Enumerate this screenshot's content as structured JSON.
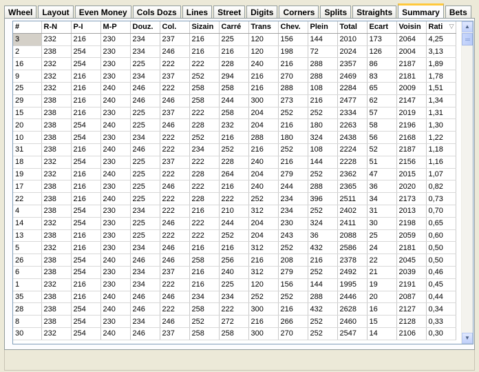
{
  "tabs": [
    {
      "label": "Wheel",
      "active": false
    },
    {
      "label": "Layout",
      "active": false
    },
    {
      "label": "Even Money",
      "active": false
    },
    {
      "label": "Cols Dozs",
      "active": false
    },
    {
      "label": "Lines",
      "active": false
    },
    {
      "label": "Street",
      "active": false
    },
    {
      "label": "Digits",
      "active": false
    },
    {
      "label": "Corners",
      "active": false
    },
    {
      "label": "Splits",
      "active": false
    },
    {
      "label": "Straights",
      "active": false
    },
    {
      "label": "Summary",
      "active": true
    },
    {
      "label": "Bets",
      "active": false
    }
  ],
  "table": {
    "columns": [
      "#",
      "R-N",
      "P-I",
      "M-P",
      "Douz.",
      "Col.",
      "Sizain",
      "Carré",
      "Trans",
      "Chev.",
      "Plein",
      "Total",
      "Ecart",
      "Voisin",
      "Rati"
    ],
    "sort_icon": "sort-descending-icon",
    "rows": [
      [
        "3",
        "232",
        "216",
        "230",
        "234",
        "237",
        "216",
        "225",
        "120",
        "156",
        "144",
        "2010",
        "173",
        "2064",
        "4,25"
      ],
      [
        "2",
        "238",
        "254",
        "230",
        "234",
        "246",
        "216",
        "216",
        "120",
        "198",
        "72",
        "2024",
        "126",
        "2004",
        "3,13"
      ],
      [
        "16",
        "232",
        "254",
        "230",
        "225",
        "222",
        "222",
        "228",
        "240",
        "216",
        "288",
        "2357",
        "86",
        "2187",
        "1,89"
      ],
      [
        "9",
        "232",
        "216",
        "230",
        "234",
        "237",
        "252",
        "294",
        "216",
        "270",
        "288",
        "2469",
        "83",
        "2181",
        "1,78"
      ],
      [
        "25",
        "232",
        "216",
        "240",
        "246",
        "222",
        "258",
        "258",
        "216",
        "288",
        "108",
        "2284",
        "65",
        "2009",
        "1,51"
      ],
      [
        "29",
        "238",
        "216",
        "240",
        "246",
        "246",
        "258",
        "244",
        "300",
        "273",
        "216",
        "2477",
        "62",
        "2147",
        "1,34"
      ],
      [
        "15",
        "238",
        "216",
        "230",
        "225",
        "237",
        "222",
        "258",
        "204",
        "252",
        "252",
        "2334",
        "57",
        "2019",
        "1,31"
      ],
      [
        "20",
        "238",
        "254",
        "240",
        "225",
        "246",
        "228",
        "232",
        "204",
        "216",
        "180",
        "2263",
        "58",
        "2196",
        "1,30"
      ],
      [
        "10",
        "238",
        "254",
        "230",
        "234",
        "222",
        "252",
        "216",
        "288",
        "180",
        "324",
        "2438",
        "56",
        "2168",
        "1,22"
      ],
      [
        "31",
        "238",
        "216",
        "240",
        "246",
        "222",
        "234",
        "252",
        "216",
        "252",
        "108",
        "2224",
        "52",
        "2187",
        "1,18"
      ],
      [
        "18",
        "232",
        "254",
        "230",
        "225",
        "237",
        "222",
        "228",
        "240",
        "216",
        "144",
        "2228",
        "51",
        "2156",
        "1,16"
      ],
      [
        "19",
        "232",
        "216",
        "240",
        "225",
        "222",
        "228",
        "264",
        "204",
        "279",
        "252",
        "2362",
        "47",
        "2015",
        "1,07"
      ],
      [
        "17",
        "238",
        "216",
        "230",
        "225",
        "246",
        "222",
        "216",
        "240",
        "244",
        "288",
        "2365",
        "36",
        "2020",
        "0,82"
      ],
      [
        "22",
        "238",
        "216",
        "240",
        "225",
        "222",
        "228",
        "222",
        "252",
        "234",
        "396",
        "2511",
        "34",
        "2173",
        "0,73"
      ],
      [
        "4",
        "238",
        "254",
        "230",
        "234",
        "222",
        "216",
        "210",
        "312",
        "234",
        "252",
        "2402",
        "31",
        "2013",
        "0,70"
      ],
      [
        "14",
        "232",
        "254",
        "230",
        "225",
        "246",
        "222",
        "244",
        "204",
        "230",
        "324",
        "2411",
        "30",
        "2198",
        "0,65"
      ],
      [
        "13",
        "238",
        "216",
        "230",
        "225",
        "222",
        "222",
        "252",
        "204",
        "243",
        "36",
        "2088",
        "25",
        "2059",
        "0,60"
      ],
      [
        "5",
        "232",
        "216",
        "230",
        "234",
        "246",
        "216",
        "216",
        "312",
        "252",
        "432",
        "2586",
        "24",
        "2181",
        "0,50"
      ],
      [
        "26",
        "238",
        "254",
        "240",
        "246",
        "246",
        "258",
        "256",
        "216",
        "208",
        "216",
        "2378",
        "22",
        "2045",
        "0,50"
      ],
      [
        "6",
        "238",
        "254",
        "230",
        "234",
        "237",
        "216",
        "240",
        "312",
        "279",
        "252",
        "2492",
        "21",
        "2039",
        "0,46"
      ],
      [
        "1",
        "232",
        "216",
        "230",
        "234",
        "222",
        "216",
        "225",
        "120",
        "156",
        "144",
        "1995",
        "19",
        "2191",
        "0,45"
      ],
      [
        "35",
        "238",
        "216",
        "240",
        "246",
        "246",
        "234",
        "234",
        "252",
        "252",
        "288",
        "2446",
        "20",
        "2087",
        "0,44"
      ],
      [
        "28",
        "238",
        "254",
        "240",
        "246",
        "222",
        "258",
        "222",
        "300",
        "216",
        "432",
        "2628",
        "16",
        "2127",
        "0,34"
      ],
      [
        "8",
        "238",
        "254",
        "230",
        "234",
        "246",
        "252",
        "272",
        "216",
        "266",
        "252",
        "2460",
        "15",
        "2128",
        "0,33"
      ],
      [
        "30",
        "232",
        "254",
        "240",
        "246",
        "237",
        "258",
        "258",
        "300",
        "270",
        "252",
        "2547",
        "14",
        "2106",
        "0,30"
      ]
    ]
  },
  "scrollbar": {
    "up_icon": "scroll-up-arrow-icon",
    "down_icon": "scroll-down-arrow-icon"
  }
}
